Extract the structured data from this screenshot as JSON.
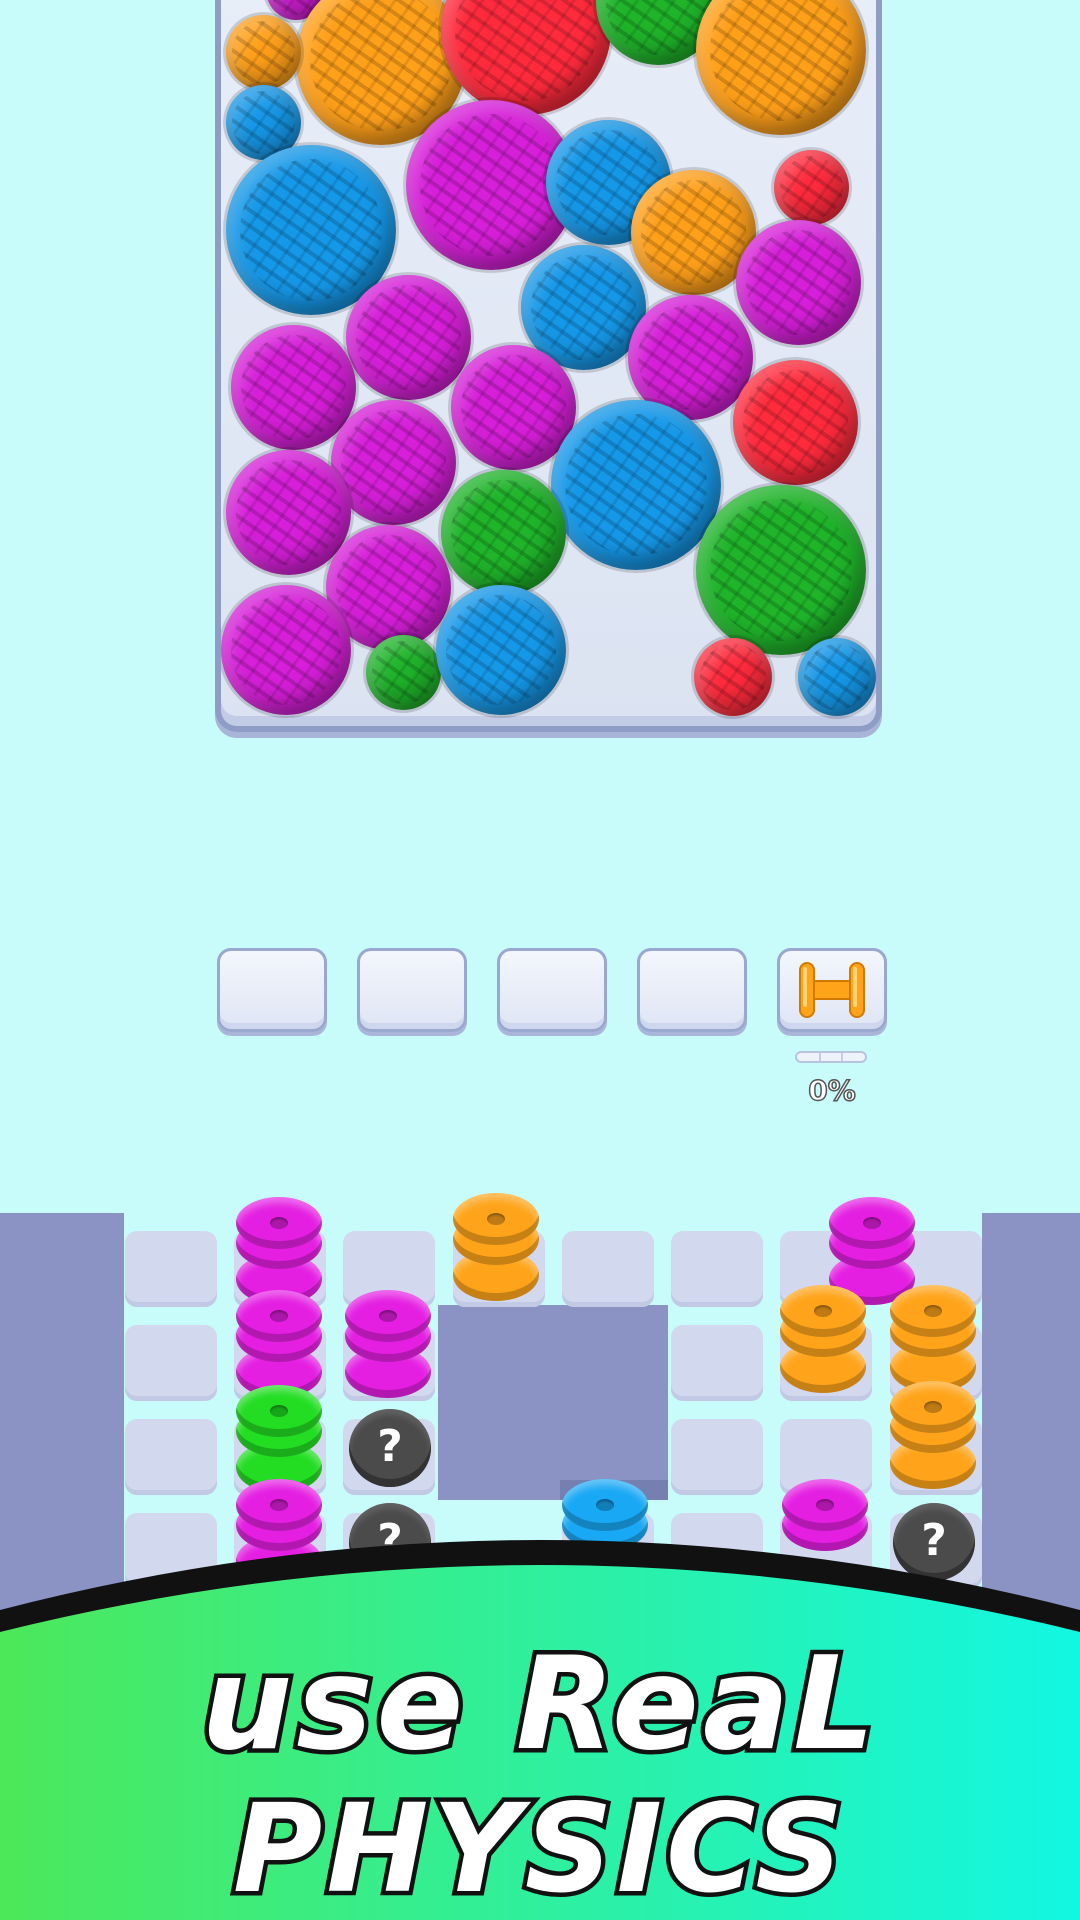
{
  "jar": {
    "balls": [
      {
        "color": "#d61fd8"
      },
      {
        "color": "#ffa01a"
      },
      {
        "color": "#ff2b3d"
      },
      {
        "color": "#1fb42a"
      },
      {
        "color": "#ffa01a"
      },
      {
        "color": "#ffa01a"
      },
      {
        "color": "#1698e8"
      },
      {
        "color": "#d61fd8"
      },
      {
        "color": "#1698e8"
      },
      {
        "color": "#ffa01a"
      },
      {
        "color": "#ff2b3d"
      },
      {
        "color": "#1698e8"
      },
      {
        "color": "#d61fd8"
      },
      {
        "color": "#1698e8"
      },
      {
        "color": "#d61fd8"
      },
      {
        "color": "#d61fd8"
      },
      {
        "color": "#d61fd8"
      },
      {
        "color": "#d61fd8"
      },
      {
        "color": "#ff2b3d"
      },
      {
        "color": "#1698e8"
      },
      {
        "color": "#d61fd8"
      },
      {
        "color": "#d61fd8"
      },
      {
        "color": "#1fb42a"
      },
      {
        "color": "#1fb42a"
      },
      {
        "color": "#d61fd8"
      },
      {
        "color": "#d61fd8"
      },
      {
        "color": "#1fb42a"
      },
      {
        "color": "#1698e8"
      },
      {
        "color": "#ff2b3d"
      },
      {
        "color": "#1698e8"
      }
    ]
  },
  "slots": {
    "items": [
      {
        "filled": false
      },
      {
        "filled": false
      },
      {
        "filled": false
      },
      {
        "filled": false
      },
      {
        "filled": true,
        "spool_color": "#ffa41a"
      }
    ]
  },
  "progress": {
    "label": "0%",
    "value": 0
  },
  "board": {
    "spools": [
      {
        "color": "#e41fe2",
        "stack": [
          "disc",
          "disc"
        ]
      },
      {
        "color": "#ffa41a",
        "stack": [
          "disc",
          "disc"
        ]
      },
      {
        "color": "#e41fe2",
        "stack": [
          "disc",
          "disc"
        ]
      },
      {
        "color": "#e41fe2",
        "stack": [
          "disc",
          "disc"
        ]
      },
      {
        "color": "#e41fe2",
        "stack": [
          "disc",
          "disc"
        ]
      },
      {
        "color": "#ffa41a",
        "stack": [
          "disc",
          "disc"
        ]
      },
      {
        "color": "#ffa41a",
        "stack": [
          "disc",
          "disc"
        ]
      },
      {
        "color": "#22dd22",
        "stack": [
          "disc",
          "disc"
        ]
      },
      {
        "color": "#ffa41a",
        "stack": [
          "disc",
          "disc"
        ]
      },
      {
        "color": "#e41fe2",
        "stack": [
          "disc",
          "disc"
        ]
      },
      {
        "color": "#19a8f4",
        "stack": [
          "disc"
        ]
      },
      {
        "color": "#e41fe2",
        "stack": [
          "disc"
        ]
      }
    ],
    "mystery_symbol": "?"
  },
  "banner": {
    "line1": "use ReaL",
    "line2": "PHYSICS",
    "gradient": [
      "#4ce85a",
      "#12f7e2"
    ],
    "edge_color": "#111111"
  }
}
